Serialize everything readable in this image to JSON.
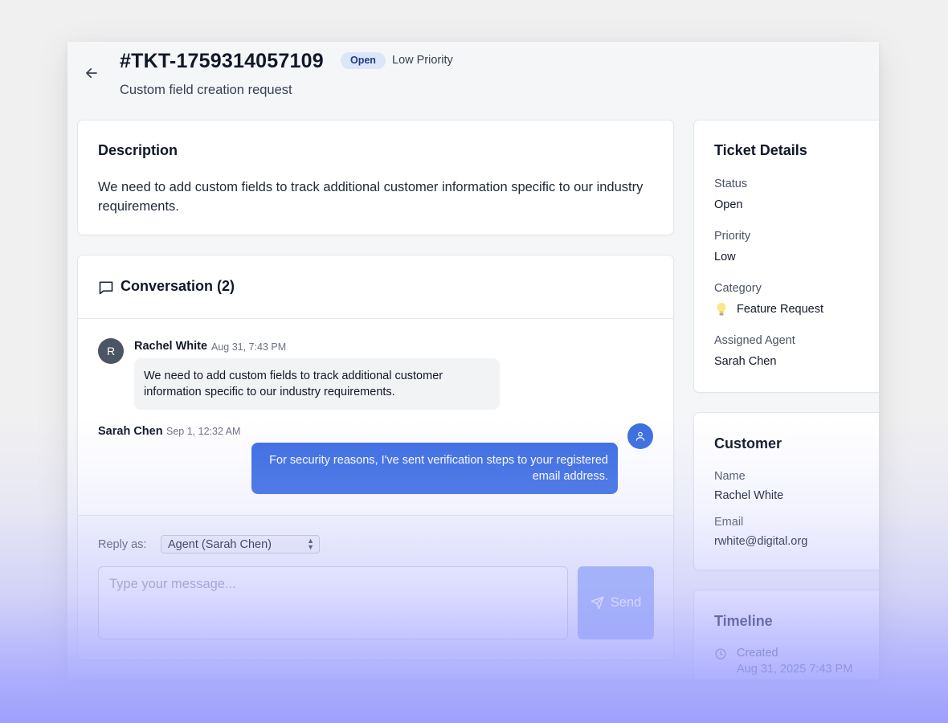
{
  "header": {
    "ticket_id": "#TKT-1759314057109",
    "status_badge": "Open",
    "priority": "Low Priority",
    "subtitle": "Custom field creation request"
  },
  "description": {
    "heading": "Description",
    "text": "We need to add custom fields to track additional customer information specific to our industry requirements."
  },
  "conversation": {
    "heading": "Conversation (2)",
    "messages": [
      {
        "avatar_initial": "R",
        "author": "Rachel White",
        "time": "Aug 31, 7:43 PM",
        "text": "We need to add custom fields to track additional customer information specific to our industry requirements."
      },
      {
        "author": "Sarah Chen",
        "time": "Sep 1, 12:32 AM",
        "text": "For security reasons, I've sent verification steps to your registered email address."
      }
    ],
    "reply": {
      "label": "Reply as:",
      "selected": "Agent (Sarah Chen)",
      "placeholder": "Type your message...",
      "send_label": "Send"
    }
  },
  "ticket_details": {
    "heading": "Ticket Details",
    "status_label": "Status",
    "status_value": "Open",
    "priority_label": "Priority",
    "priority_value": "Low",
    "category_label": "Category",
    "category_value": "Feature Request",
    "agent_label": "Assigned Agent",
    "agent_value": "Sarah Chen"
  },
  "customer": {
    "heading": "Customer",
    "name_label": "Name",
    "name_value": "Rachel White",
    "email_label": "Email",
    "email_value": "rwhite@digital.org"
  },
  "timeline": {
    "heading": "Timeline",
    "created_label": "Created",
    "created_value": "Aug 31, 2025 7:43 PM"
  },
  "colors": {
    "accent": "#3d6ee2",
    "badge_bg": "#dbe6f8",
    "send_disabled": "#9bb3f5"
  },
  "icons": {
    "back": "arrow-left-icon",
    "conversation": "message-square-icon",
    "agent_avatar": "user-icon",
    "send": "send-icon",
    "category": "lightbulb-icon",
    "timeline": "clock-icon"
  }
}
